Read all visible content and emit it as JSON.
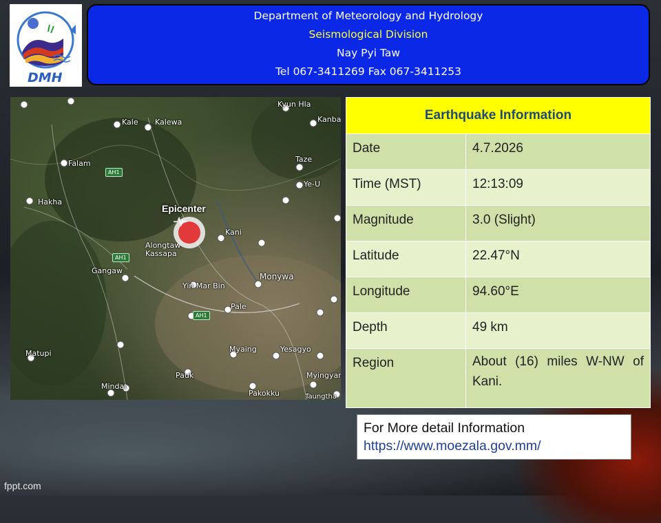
{
  "logo": {
    "text": "DMH"
  },
  "header": {
    "line1": "Department of Meteorology and Hydrology",
    "line2": "Seismological Division",
    "line3": "Nay Pyi Taw",
    "line4": "Tel 067-3411269 Fax 067-3411253"
  },
  "map": {
    "epicenter_label": "Epicenter",
    "places": [
      "Kyun Hla",
      "Kale",
      "Kalewa",
      "Kanbal",
      "Falam",
      "Taze",
      "Ye-U",
      "Hakha",
      "Kani",
      "Alongtaw Kassapa",
      "Gangaw",
      "Monywa",
      "Yin Mar Bin",
      "Pale",
      "Matupi",
      "Myaing",
      "Yesagyo",
      "Pauk",
      "Myingyan",
      "Mindat",
      "Pakokku",
      "Taungtha"
    ],
    "road_badges": [
      "AH1",
      "AH1",
      "AH1"
    ]
  },
  "info": {
    "title": "Earthquake Information",
    "rows": [
      {
        "label": "Date",
        "value": "4.7.2026"
      },
      {
        "label": "Time (MST)",
        "value": "12:13:09"
      },
      {
        "label": "Magnitude",
        "value": "3.0 (Slight)"
      },
      {
        "label": "Latitude",
        "value": "22.47°N"
      },
      {
        "label": "Longitude",
        "value": "94.60°E"
      },
      {
        "label": "Depth",
        "value": "49 km"
      },
      {
        "label": "Region",
        "value": "About (16) miles W-NW of Kani."
      }
    ]
  },
  "more": {
    "line1": "For More detail Information",
    "link": "https://www.moezala.gov.mm/"
  },
  "footer": {
    "text": "fppt.com"
  },
  "colors": {
    "header_bg": "#0a28e6",
    "title_bg": "#ffff00",
    "row_dark": "#cfe1a8",
    "row_light": "#e7f1cc"
  }
}
